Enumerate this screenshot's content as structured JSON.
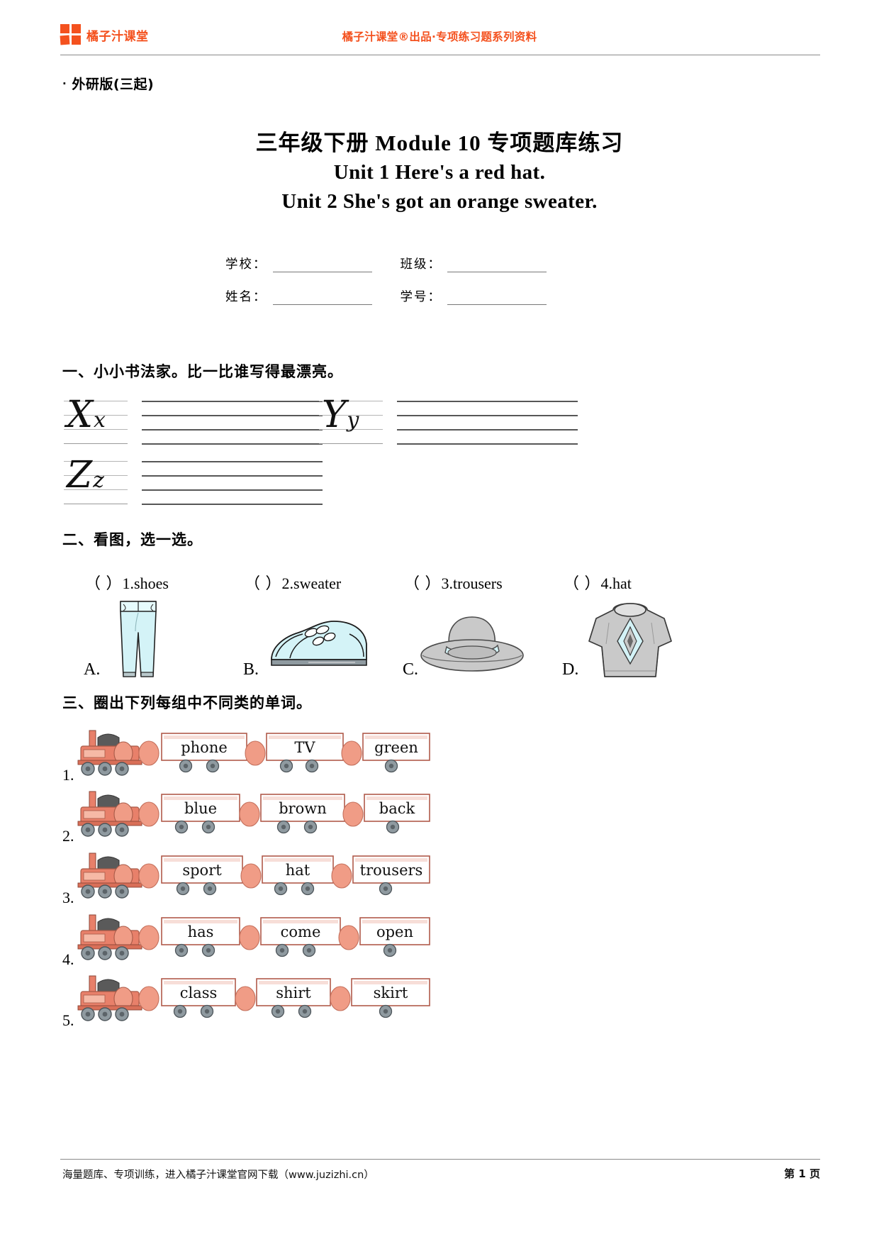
{
  "header": {
    "logo_text": "橘子汁课堂",
    "center_text": "橘子汁课堂®出品·专项练习题系列资料",
    "accent_color": "#f4511e"
  },
  "edition": "外研版(三起)",
  "title": {
    "line1": "三年级下册 Module 10 专项题库练习",
    "line2": "Unit 1 Here's a red hat.",
    "line3": "Unit 2 She's got an orange sweater."
  },
  "info_fields": [
    {
      "label": "学校：",
      "value": ""
    },
    {
      "label": "班级：",
      "value": ""
    },
    {
      "label": "姓名：",
      "value": ""
    },
    {
      "label": "学号：",
      "value": ""
    }
  ],
  "sections": {
    "one": {
      "heading": "一、小小书法家。比一比谁写得最漂亮。",
      "letters": [
        {
          "upper": "X",
          "lower": "x"
        },
        {
          "upper": "Y",
          "lower": "y"
        },
        {
          "upper": "Z",
          "lower": "z"
        }
      ]
    },
    "two": {
      "heading": "二、看图，选一选。",
      "questions": [
        {
          "paren": "（      ）",
          "num": "1.",
          "word": "shoes"
        },
        {
          "paren": "（      ）",
          "num": "2.",
          "word": "sweater"
        },
        {
          "paren": "（      ）",
          "num": "3.",
          "word": "trousers"
        },
        {
          "paren": "（      ）",
          "num": "4.",
          "word": "hat"
        }
      ],
      "pictures": [
        {
          "label": "A.",
          "alt": "trousers-picture"
        },
        {
          "label": "B.",
          "alt": "shoe-picture"
        },
        {
          "label": "C.",
          "alt": "hat-picture"
        },
        {
          "label": "D.",
          "alt": "sweater-picture"
        }
      ],
      "picture_colors": {
        "cloth_fill": "#d4f3f7",
        "outline": "#1a1a1a",
        "grey_fill": "#c9c9c9"
      }
    },
    "three": {
      "heading": "三、圈出下列每组中不同类的单词。",
      "train_colors": {
        "body": "#e8806a",
        "body_light": "#f09c86",
        "box_border": "#b05a4a",
        "wheel": "#8f9aa0"
      },
      "rows": [
        {
          "num": "1.",
          "words": [
            "phone",
            "TV",
            "green"
          ]
        },
        {
          "num": "2.",
          "words": [
            "blue",
            "brown",
            "back"
          ]
        },
        {
          "num": "3.",
          "words": [
            "sport",
            "hat",
            "trousers"
          ]
        },
        {
          "num": "4.",
          "words": [
            "has",
            "come",
            "open"
          ]
        },
        {
          "num": "5.",
          "words": [
            "class",
            "shirt",
            "skirt"
          ]
        }
      ]
    }
  },
  "footer": {
    "left": "海量题库、专项训练，进入橘子汁课堂官网下载（www.juzizhi.cn）",
    "right": "第 1 页"
  }
}
